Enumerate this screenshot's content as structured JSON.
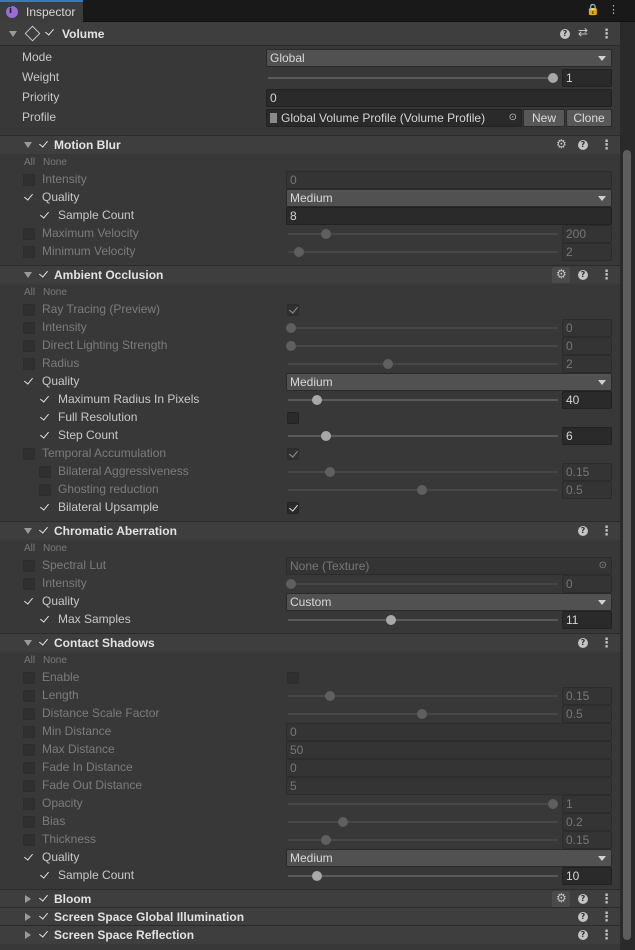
{
  "window": {
    "tab_title": "Inspector"
  },
  "component": {
    "title": "Volume"
  },
  "volume_fields": {
    "mode_label": "Mode",
    "mode_value": "Global",
    "weight_label": "Weight",
    "weight_value": "1",
    "priority_label": "Priority",
    "priority_value": "0",
    "profile_label": "Profile",
    "profile_value": "Global Volume Profile (Volume Profile)",
    "new_label": "New",
    "clone_label": "Clone"
  },
  "all_label": "All",
  "none_label": "None",
  "motion_blur": {
    "title": "Motion Blur",
    "intensity_label": "Intensity",
    "intensity_value": "0",
    "quality_label": "Quality",
    "quality_value": "Medium",
    "sample_count_label": "Sample Count",
    "sample_count_value": "8",
    "max_velocity_label": "Maximum Velocity",
    "max_velocity_value": "200",
    "min_velocity_label": "Minimum Velocity",
    "min_velocity_value": "2"
  },
  "ambient_occlusion": {
    "title": "Ambient Occlusion",
    "ray_tracing_label": "Ray Tracing (Preview)",
    "intensity_label": "Intensity",
    "intensity_value": "0",
    "direct_lighting_label": "Direct Lighting Strength",
    "direct_lighting_value": "0",
    "radius_label": "Radius",
    "radius_value": "2",
    "quality_label": "Quality",
    "quality_value": "Medium",
    "max_radius_label": "Maximum Radius In Pixels",
    "max_radius_value": "40",
    "full_res_label": "Full Resolution",
    "step_count_label": "Step Count",
    "step_count_value": "6",
    "temporal_label": "Temporal Accumulation",
    "bilateral_aggr_label": "Bilateral Aggressiveness",
    "bilateral_aggr_value": "0.15",
    "ghosting_label": "Ghosting reduction",
    "ghosting_value": "0.5",
    "bilateral_up_label": "Bilateral Upsample"
  },
  "chromatic_aberration": {
    "title": "Chromatic Aberration",
    "spectral_lut_label": "Spectral Lut",
    "spectral_lut_value": "None (Texture)",
    "intensity_label": "Intensity",
    "intensity_value": "0",
    "quality_label": "Quality",
    "quality_value": "Custom",
    "max_samples_label": "Max Samples",
    "max_samples_value": "11"
  },
  "contact_shadows": {
    "title": "Contact Shadows",
    "enable_label": "Enable",
    "length_label": "Length",
    "length_value": "0.15",
    "distance_scale_label": "Distance Scale Factor",
    "distance_scale_value": "0.5",
    "min_distance_label": "Min Distance",
    "min_distance_value": "0",
    "max_distance_label": "Max Distance",
    "max_distance_value": "50",
    "fade_in_label": "Fade In Distance",
    "fade_in_value": "0",
    "fade_out_label": "Fade Out Distance",
    "fade_out_value": "5",
    "opacity_label": "Opacity",
    "opacity_value": "1",
    "bias_label": "Bias",
    "bias_value": "0.2",
    "thickness_label": "Thickness",
    "thickness_value": "0.15",
    "quality_label": "Quality",
    "quality_value": "Medium",
    "sample_count_label": "Sample Count",
    "sample_count_value": "10"
  },
  "collapsed": {
    "bloom": "Bloom",
    "ssgi": "Screen Space Global Illumination",
    "ssr": "Screen Space Reflection"
  }
}
